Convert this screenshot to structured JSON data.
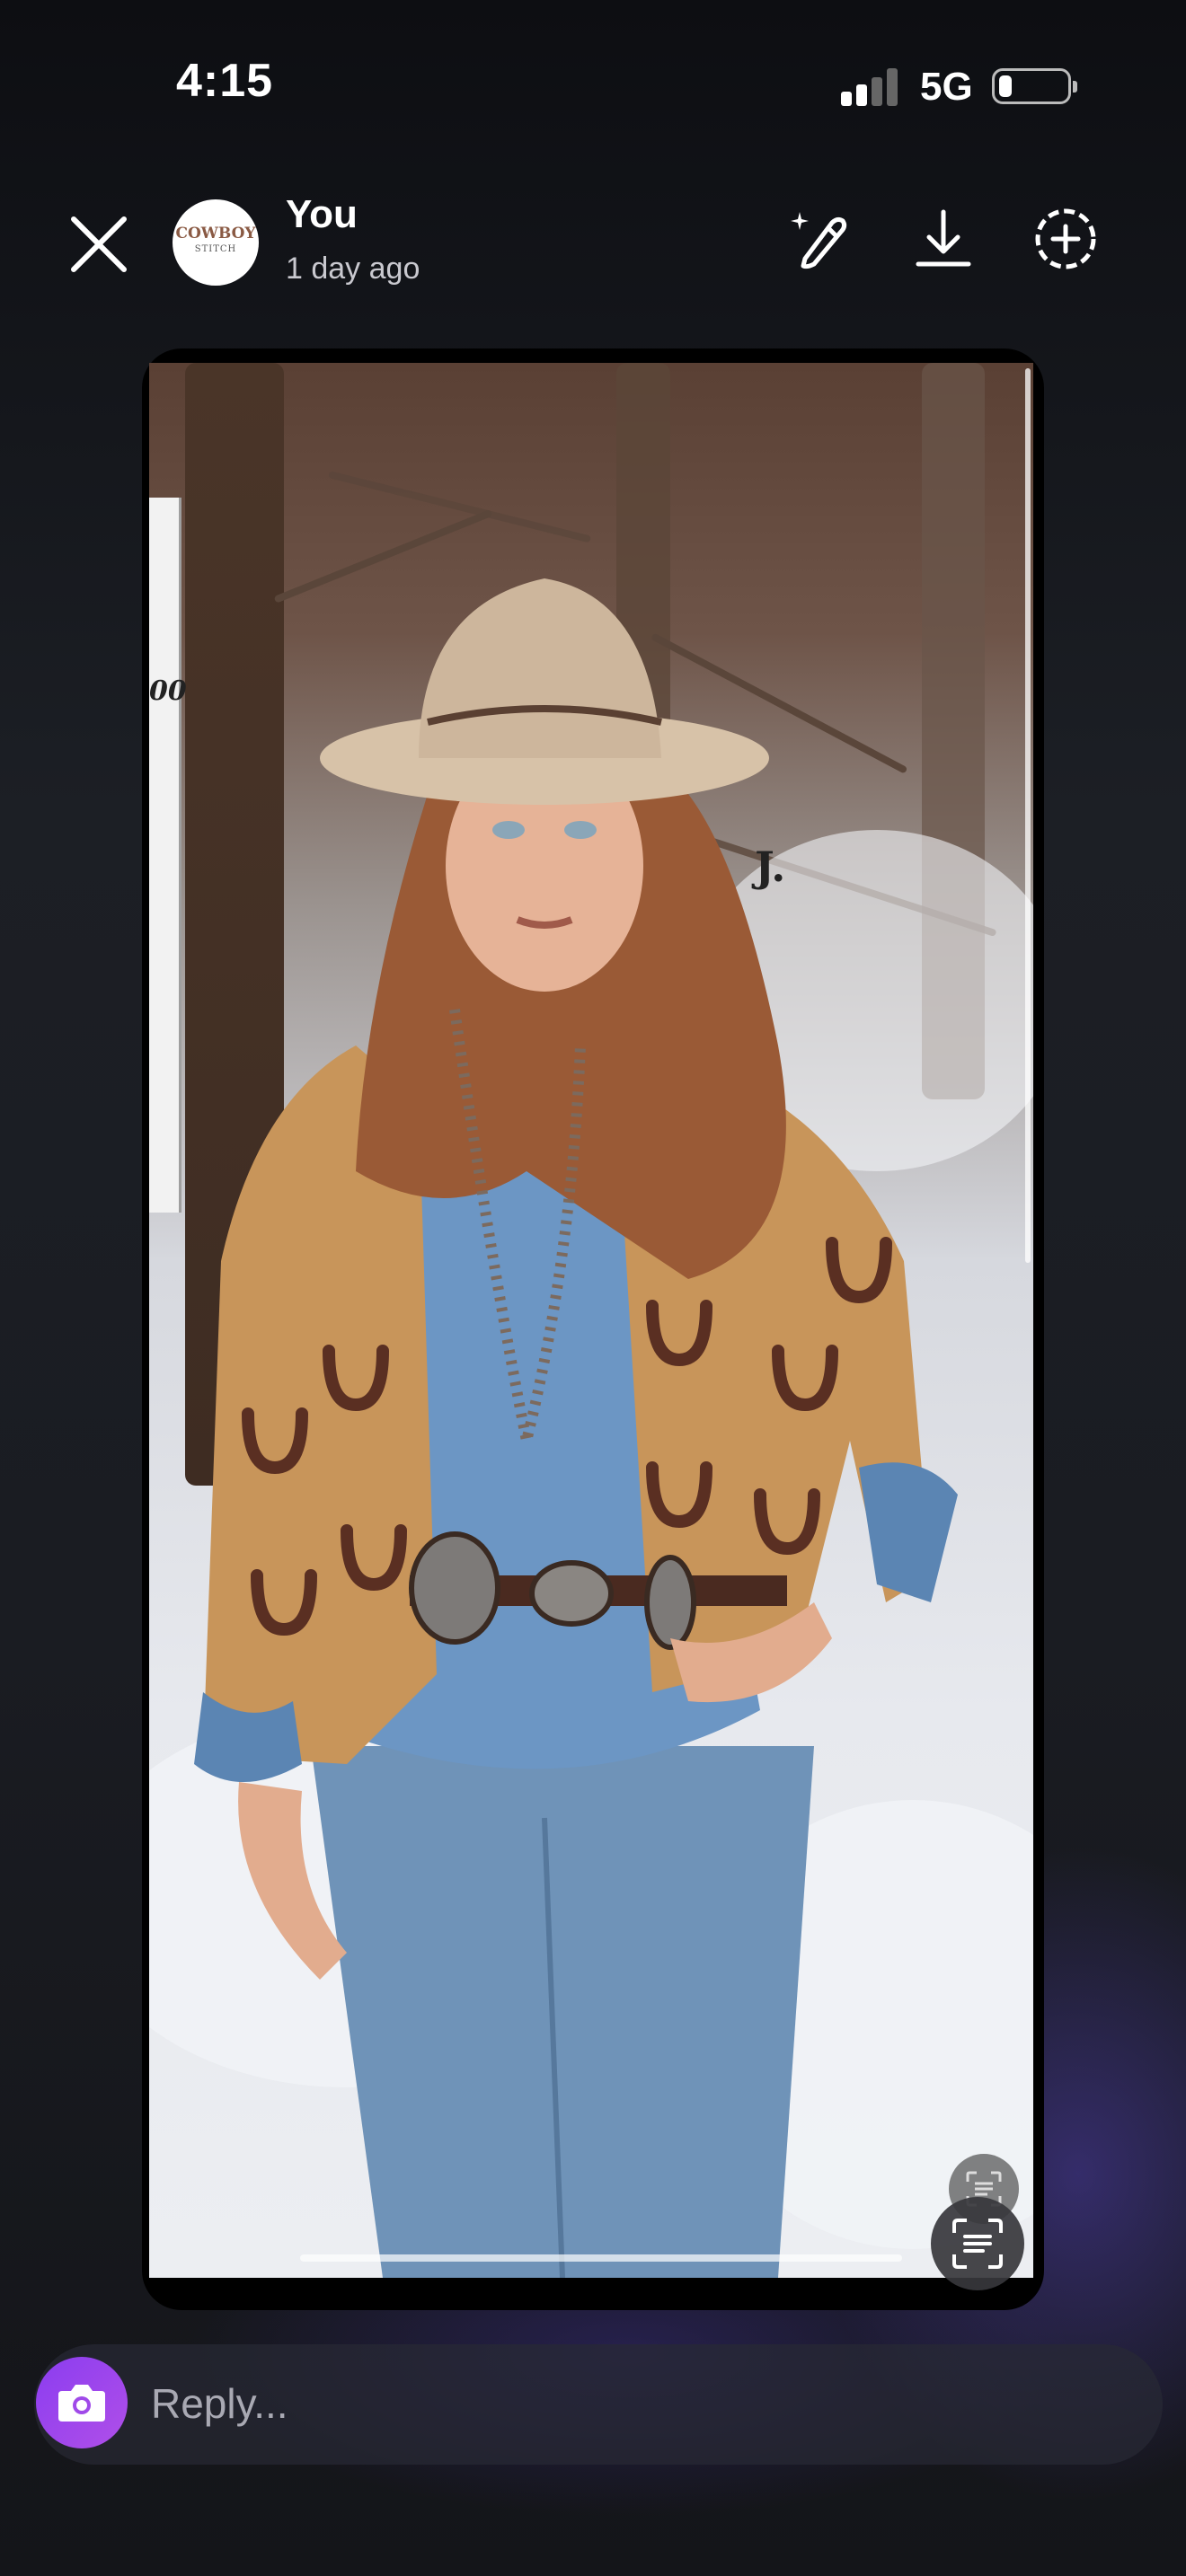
{
  "status_bar": {
    "time": "4:15",
    "network": "5G",
    "battery_level": 0.2
  },
  "header": {
    "user_name": "You",
    "post_time": "1 day ago",
    "avatar_lines": [
      "COWBOY",
      "STITCH"
    ]
  },
  "story": {
    "side_text": "00",
    "brand_mark": "J.",
    "progress": 1.0
  },
  "reply": {
    "placeholder": "Reply..."
  },
  "icons": {
    "close": "close-icon",
    "draw": "draw-icon",
    "download": "download-icon",
    "add_to_story": "add-to-story-icon",
    "text_recognition": "text-recognition-icon",
    "camera": "camera-icon"
  },
  "colors": {
    "accent": "#9b46ee",
    "background": "#14161b"
  }
}
